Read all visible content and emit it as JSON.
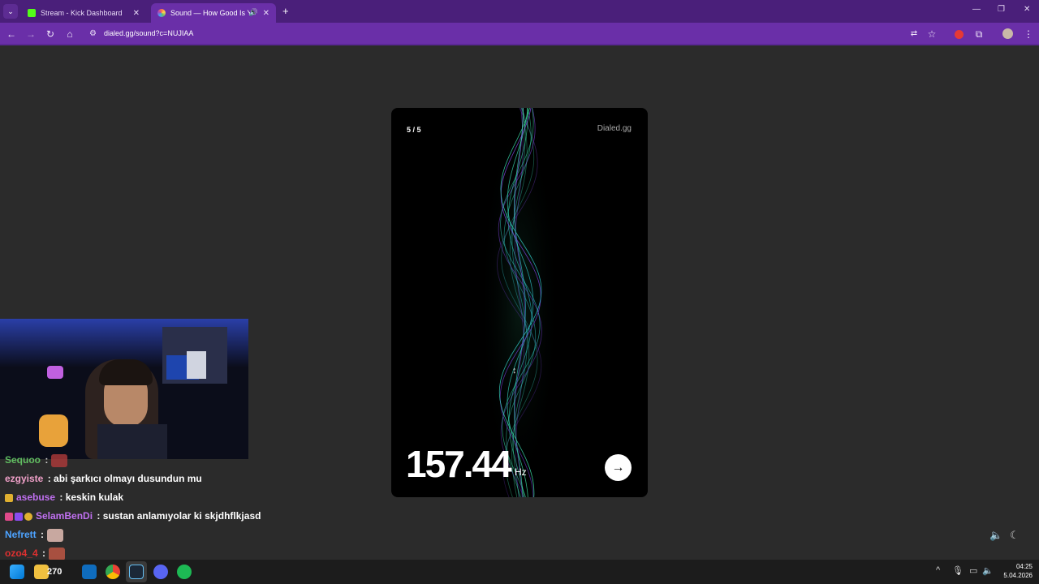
{
  "tabs": [
    {
      "title": "Stream - Kick Dashboard",
      "active": false,
      "favicon_color": "#53fc18"
    },
    {
      "title": "Sound — How Good Is You",
      "active": true,
      "favicon_color": "#ff7043"
    }
  ],
  "new_tab": "+",
  "window_controls": {
    "minimize": "—",
    "restore": "❐",
    "close": "✕"
  },
  "toolbar": {
    "url": "dialed.gg/sound?c=NUJIAA"
  },
  "card": {
    "counter": "5 / 5",
    "brand": "Dialed.gg",
    "frequency": "157.44",
    "unit": "Hz",
    "next_arrow": "→"
  },
  "chat": [
    {
      "user": "Sequoo",
      "sep": " :",
      "text": "",
      "color": "#6fe26f",
      "emote": true
    },
    {
      "user": "ezgyiste",
      "sep": " : ",
      "text": "abi şarkıcı olmayı dusundun mu",
      "color": "#f0a0c8"
    },
    {
      "user": "asebuse",
      "sep": " : ",
      "text": "keskin kulak",
      "color": "#c070f0"
    },
    {
      "user": "SelamBenDi",
      "sep": " : ",
      "text": "sustan anlamıyolar ki skjdhflkjasd",
      "color": "#c070f0"
    },
    {
      "user": "Nefrett",
      "sep": " :",
      "text": "",
      "color": "#4da3ff",
      "emote": true
    },
    {
      "user": "ozo4_4",
      "sep": " :",
      "text": "",
      "color": "#e03030",
      "emote": true
    }
  ],
  "taskbar": {
    "badge": "270",
    "tray_chevron": "^",
    "time": "04:25",
    "date": "5.04.2026"
  },
  "colors": {
    "tab_bar": "#4a1f7a",
    "toolbar": "#6a2fa8",
    "page_bg": "#2b2b2b",
    "wave_green": "#3de0a0",
    "wave_purple": "#8a4cf0"
  }
}
